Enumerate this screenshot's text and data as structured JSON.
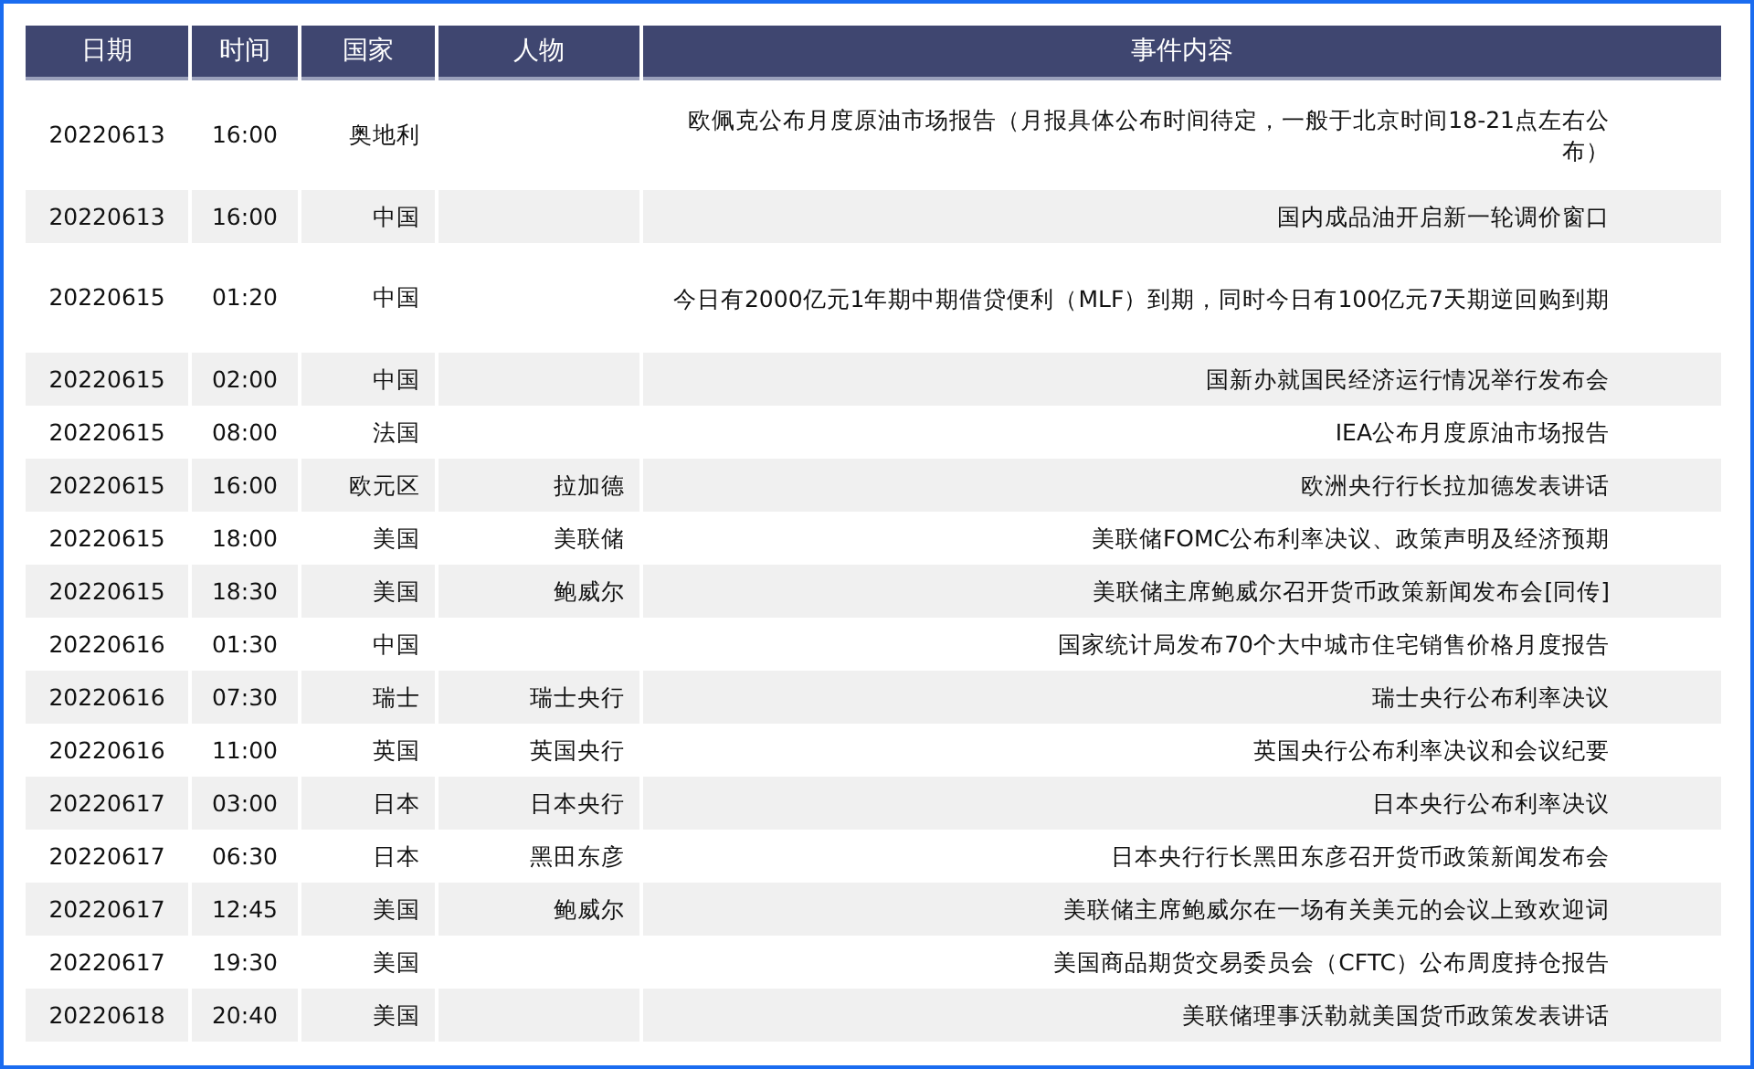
{
  "table": {
    "columns": [
      "日期",
      "时间",
      "国家",
      "人物",
      "事件内容"
    ],
    "rows": [
      {
        "date": "20220613",
        "time": "16:00",
        "country": "奥地利",
        "person": "",
        "event": "欧佩克公布月度原油市场报告（月报具体公布时间待定，一般于北京时间18-21点左右公布）"
      },
      {
        "date": "20220613",
        "time": "16:00",
        "country": "中国",
        "person": "",
        "event": "国内成品油开启新一轮调价窗口"
      },
      {
        "date": "20220615",
        "time": "01:20",
        "country": "中国",
        "person": "",
        "event": "今日有2000亿元1年期中期借贷便利（MLF）到期，同时今日有100亿元7天期逆回购到期"
      },
      {
        "date": "20220615",
        "time": "02:00",
        "country": "中国",
        "person": "",
        "event": "国新办就国民经济运行情况举行发布会"
      },
      {
        "date": "20220615",
        "time": "08:00",
        "country": "法国",
        "person": "",
        "event": "IEA公布月度原油市场报告"
      },
      {
        "date": "20220615",
        "time": "16:00",
        "country": "欧元区",
        "person": "拉加德",
        "event": "欧洲央行行长拉加德发表讲话"
      },
      {
        "date": "20220615",
        "time": "18:00",
        "country": "美国",
        "person": "美联储",
        "event": "美联储FOMC公布利率决议、政策声明及经济预期"
      },
      {
        "date": "20220615",
        "time": "18:30",
        "country": "美国",
        "person": "鲍威尔",
        "event": "美联储主席鲍威尔召开货币政策新闻发布会[同传]"
      },
      {
        "date": "20220616",
        "time": "01:30",
        "country": "中国",
        "person": "",
        "event": "国家统计局发布70个大中城市住宅销售价格月度报告"
      },
      {
        "date": "20220616",
        "time": "07:30",
        "country": "瑞士",
        "person": "瑞士央行",
        "event": "瑞士央行公布利率决议"
      },
      {
        "date": "20220616",
        "time": "11:00",
        "country": "英国",
        "person": "英国央行",
        "event": "英国央行公布利率决议和会议纪要"
      },
      {
        "date": "20220617",
        "time": "03:00",
        "country": "日本",
        "person": "日本央行",
        "event": "日本央行公布利率决议"
      },
      {
        "date": "20220617",
        "time": "06:30",
        "country": "日本",
        "person": "黑田东彦",
        "event": "日本央行行长黑田东彦召开货币政策新闻发布会"
      },
      {
        "date": "20220617",
        "time": "12:45",
        "country": "美国",
        "person": "鲍威尔",
        "event": "美联储主席鲍威尔在一场有关美元的会议上致欢迎词"
      },
      {
        "date": "20220617",
        "time": "19:30",
        "country": "美国",
        "person": "",
        "event": "美国商品期货交易委员会（CFTC）公布周度持仓报告"
      },
      {
        "date": "20220618",
        "time": "20:40",
        "country": "美国",
        "person": "",
        "event": "美联储理事沃勒就美国货币政策发表讲话"
      }
    ]
  }
}
